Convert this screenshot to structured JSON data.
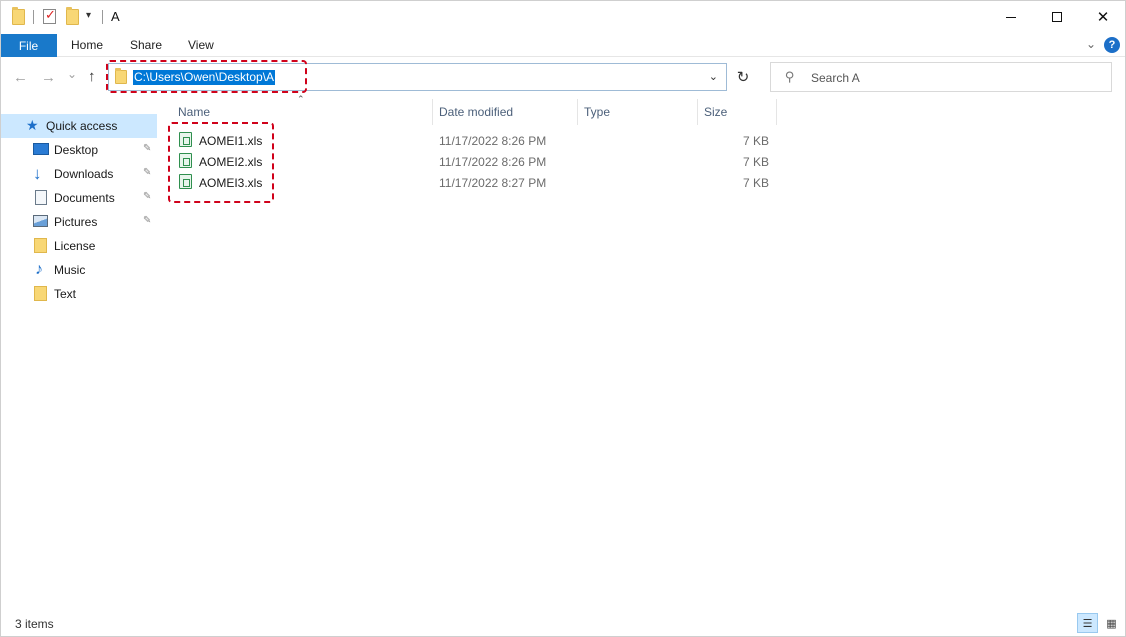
{
  "window": {
    "title": "A",
    "qa_dropdown": "▾",
    "minimize_glyph": "",
    "maximize_glyph": "",
    "close_glyph": "✕"
  },
  "ribbon": {
    "tabs": [
      "File",
      "Home",
      "Share",
      "View"
    ],
    "collapse_glyph": "⌄",
    "help_glyph": "?"
  },
  "nav": {
    "back_glyph": "←",
    "forward_glyph": "→",
    "recent_glyph": "⌄",
    "up_glyph": "↑",
    "address": "C:\\Users\\Owen\\Desktop\\A",
    "address_dropdown_glyph": "⌄",
    "refresh_glyph": "↻"
  },
  "search": {
    "placeholder": "Search A",
    "icon_glyph": "⚲"
  },
  "sidebar": {
    "items": [
      {
        "label": "Quick access",
        "icon": "star-icon",
        "pinned": false
      },
      {
        "label": "Desktop",
        "icon": "desktop-icon",
        "pinned": true
      },
      {
        "label": "Downloads",
        "icon": "download-icon",
        "pinned": true
      },
      {
        "label": "Documents",
        "icon": "document-icon",
        "pinned": true
      },
      {
        "label": "Pictures",
        "icon": "pictures-icon",
        "pinned": true
      },
      {
        "label": "License",
        "icon": "folder-icon",
        "pinned": false
      },
      {
        "label": "Music",
        "icon": "music-icon",
        "pinned": false
      },
      {
        "label": "Text",
        "icon": "folder-icon",
        "pinned": false
      }
    ],
    "pin_glyph": "📌"
  },
  "columns": {
    "name": "Name",
    "date_modified": "Date modified",
    "type": "Type",
    "size": "Size",
    "sort_glyph": "⌃"
  },
  "files": [
    {
      "name": "AOMEI1.xls",
      "date": "11/17/2022 8:26 PM",
      "type": "",
      "size": "7 KB"
    },
    {
      "name": "AOMEI2.xls",
      "date": "11/17/2022 8:26 PM",
      "type": "",
      "size": "7 KB"
    },
    {
      "name": "AOMEI3.xls",
      "date": "11/17/2022 8:27 PM",
      "type": "",
      "size": "7 KB"
    }
  ],
  "status": {
    "item_count": "3 items",
    "details_view_glyph": "☰",
    "tiles_view_glyph": "▦"
  },
  "colors": {
    "accent": "#1979ca",
    "selection": "#cce8ff",
    "annotation": "#d0021b"
  }
}
